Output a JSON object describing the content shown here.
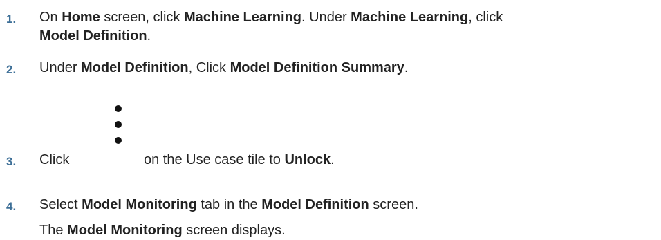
{
  "steps": [
    {
      "number": "1.",
      "line1": {
        "t1": "On ",
        "b1": "Home",
        "t2": " screen, click ",
        "b2": "Machine Learning",
        "t3": ". Under ",
        "b3": "Machine Learning",
        "t4": ", click"
      },
      "line2": {
        "b1": "Model Definition",
        "t1": "."
      }
    },
    {
      "number": "2.",
      "t1": "Under ",
      "b1": "Model Definition",
      "t2": ", Click ",
      "b2": "Model Definition Summary",
      "t3": "."
    },
    {
      "number": "3.",
      "t1": "Click",
      "icon": "kebab-menu-icon",
      "t2": "on the Use case tile to ",
      "b1": "Unlock",
      "t3": "."
    },
    {
      "number": "4.",
      "t1": "Select ",
      "b1": "Model Monitoring",
      "t2": " tab in the ",
      "b2": "Model Definition",
      "t3": " screen."
    }
  ],
  "result": {
    "t1": "The ",
    "b1": "Model Monitoring",
    "t2": " screen displays."
  },
  "colors": {
    "step_number": "#3d6f97",
    "text": "#222222"
  }
}
